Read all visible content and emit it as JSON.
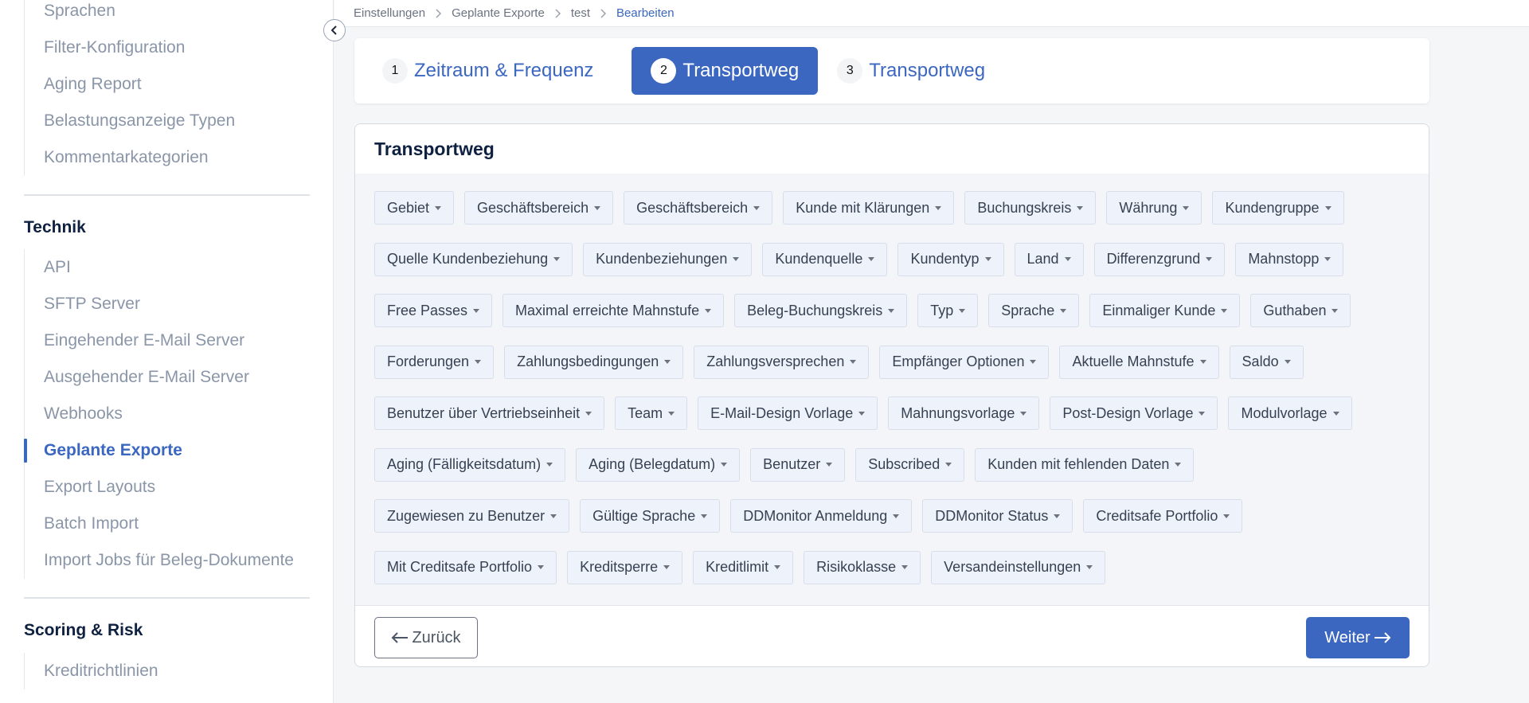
{
  "sidebar": {
    "group1": [
      "Sprachen",
      "Filter-Konfiguration",
      "Aging Report",
      "Belastungsanzeige Typen",
      "Kommentarkategorien"
    ],
    "technik_heading": "Technik",
    "group2": [
      "API",
      "SFTP Server",
      "Eingehender E-Mail Server",
      "Ausgehender E-Mail Server",
      "Webhooks",
      "Geplante Exporte",
      "Export Layouts",
      "Batch Import",
      "Import Jobs für Beleg-Dokumente"
    ],
    "active_item": "Geplante Exporte",
    "scoring_heading": "Scoring & Risk",
    "group3": [
      "Kreditrichtlinien"
    ]
  },
  "breadcrumb": [
    "Einstellungen",
    "Geplante Exporte",
    "test",
    "Bearbeiten"
  ],
  "stepper": [
    {
      "num": "1",
      "label": "Zeitraum & Frequenz"
    },
    {
      "num": "2",
      "label": "Transportweg"
    },
    {
      "num": "3",
      "label": "Transportweg"
    }
  ],
  "card": {
    "title": "Transportweg",
    "chip_rows": [
      [
        "Gebiet",
        "Geschäftsbereich",
        "Geschäftsbereich",
        "Kunde mit Klärungen",
        "Buchungskreis",
        "Währung",
        "Kundengruppe"
      ],
      [
        "Quelle Kundenbeziehung",
        "Kundenbeziehungen",
        "Kundenquelle",
        "Kundentyp",
        "Land",
        "Differenzgrund",
        "Mahnstopp"
      ],
      [
        "Free Passes",
        "Maximal erreichte Mahnstufe",
        "Beleg-Buchungskreis",
        "Typ",
        "Sprache",
        "Einmaliger Kunde",
        "Guthaben"
      ],
      [
        "Forderungen",
        "Zahlungsbedingungen",
        "Zahlungsversprechen",
        "Empfänger Optionen",
        "Aktuelle Mahnstufe",
        "Saldo"
      ],
      [
        "Benutzer über Vertriebseinheit",
        "Team",
        "E-Mail-Design Vorlage",
        "Mahnungsvorlage",
        "Post-Design Vorlage",
        "Modulvorlage"
      ],
      [
        "Aging (Fälligkeitsdatum)",
        "Aging (Belegdatum)",
        "Benutzer",
        "Subscribed",
        "Kunden mit fehlenden Daten"
      ],
      [
        "Zugewiesen zu Benutzer",
        "Gültige Sprache",
        "DDMonitor Anmeldung",
        "DDMonitor Status",
        "Creditsafe Portfolio"
      ],
      [
        "Mit Creditsafe Portfolio",
        "Kreditsperre",
        "Kreditlimit",
        "Risikoklasse",
        "Versandeinstellungen"
      ]
    ],
    "back_label": "Zurück",
    "next_label": "Weiter"
  },
  "colors": {
    "accent": "#3b67c0",
    "chip_bg": "#eef3fb",
    "heading": "#0f2140"
  }
}
